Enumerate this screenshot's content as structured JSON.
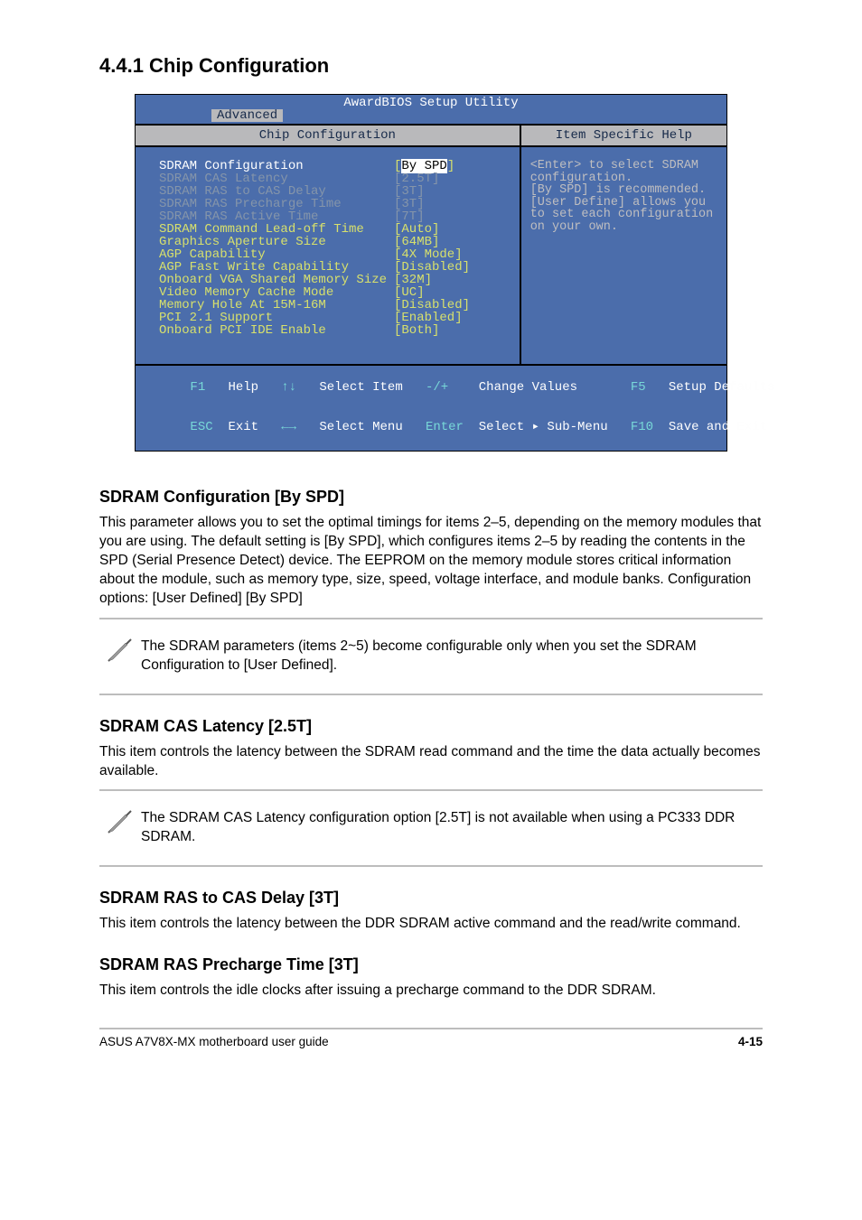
{
  "section_title": "4.4.1 Chip Configuration",
  "bios": {
    "header_title": "AwardBIOS Setup Utility",
    "active_tab": "Advanced",
    "left_panel_title": "Chip Configuration",
    "right_panel_title": "Item Specific Help",
    "help_text": "<Enter> to select SDRAM configuration.\n[By SPD] is recommended.\n[User Define] allows you to set each configuration on your own.",
    "options": [
      {
        "label": "SDRAM Configuration",
        "value": "By SPD",
        "dim": false,
        "selected": true
      },
      {
        "label": "SDRAM CAS Latency",
        "value": "2.5T",
        "dim": true,
        "selected": false
      },
      {
        "label": "SDRAM RAS to CAS Delay",
        "value": "3T",
        "dim": true,
        "selected": false
      },
      {
        "label": "SDRAM RAS Precharge Time",
        "value": "3T",
        "dim": true,
        "selected": false
      },
      {
        "label": "SDRAM RAS Active Time",
        "value": "7T",
        "dim": true,
        "selected": false
      },
      {
        "label": "SDRAM Command Lead-off Time",
        "value": "Auto",
        "dim": false,
        "selected": false
      },
      {
        "label": "Graphics Aperture Size",
        "value": "64MB",
        "dim": false,
        "selected": false
      },
      {
        "label": "AGP Capability",
        "value": "4X Mode",
        "dim": false,
        "selected": false
      },
      {
        "label": "AGP Fast Write Capability",
        "value": "Disabled",
        "dim": false,
        "selected": false
      },
      {
        "label": "Onboard VGA Shared Memory Size",
        "value": "32M",
        "dim": false,
        "selected": false
      },
      {
        "label": "Video Memory Cache Mode",
        "value": "UC",
        "dim": false,
        "selected": false
      },
      {
        "label": "Memory Hole At 15M-16M",
        "value": "Disabled",
        "dim": false,
        "selected": false
      },
      {
        "label": "PCI 2.1 Support",
        "value": "Enabled",
        "dim": false,
        "selected": false
      },
      {
        "label": "Onboard PCI IDE Enable",
        "value": "Both",
        "dim": false,
        "selected": false
      }
    ],
    "footer": {
      "l1_k1": "F1",
      "l1_a1": "Help",
      "l1_k2": "↑↓",
      "l1_a2": "Select Item",
      "l1_k3": "-/+",
      "l1_a3": "Change Values",
      "l1_k4": "F5",
      "l1_a4": "Setup Defaults",
      "l2_k1": "ESC",
      "l2_a1": "Exit",
      "l2_k2": "←→",
      "l2_a2": "Select Menu",
      "l2_k3": "Enter",
      "l2_a3": "Select ▸ Sub-Menu",
      "l2_k4": "F10",
      "l2_a4": "Save and Exit"
    }
  },
  "params": {
    "p1_title": "SDRAM Configuration [By SPD]",
    "p1_text": "This parameter allows you to set the optimal timings for items 2–5, depending on the memory modules that you are using. The default setting is [By SPD], which configures items 2–5 by reading the contents in the SPD (Serial Presence Detect) device. The EEPROM on the memory module stores critical information about the module, such as memory type, size, speed, voltage interface, and module banks. Configuration options: [User Defined] [By SPD]",
    "note1": "The SDRAM parameters (items 2~5) become configurable only when you set the SDRAM Configuration to [User Defined].",
    "p2_title": "SDRAM CAS Latency [2.5T]",
    "p2_text": "This item controls the latency between the SDRAM read command and the time the data actually becomes available.",
    "note2": "The SDRAM CAS Latency configuration option [2.5T] is not available when using a PC333 DDR SDRAM.",
    "p3_title": "SDRAM RAS to CAS Delay [3T]",
    "p3_text": "This item controls the latency between the DDR SDRAM active command and the read/write command.",
    "p4_title": "SDRAM RAS Precharge Time [3T]",
    "p4_text": "This item controls the idle clocks after issuing a precharge command to the DDR SDRAM."
  },
  "page_footer": {
    "left": "ASUS A7V8X-MX motherboard user guide",
    "right": "4-15"
  }
}
